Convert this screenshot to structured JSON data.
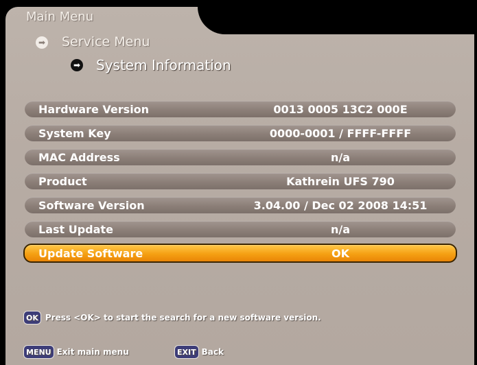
{
  "breadcrumb": {
    "main": "Main Menu",
    "service": "Service Menu",
    "current": "System Information"
  },
  "rows": [
    {
      "label": "Hardware Version",
      "value": "0013 0005 13C2 000E"
    },
    {
      "label": "System Key",
      "value": "0000-0001 / FFFF-FFFF"
    },
    {
      "label": "MAC Address",
      "value": "n/a"
    },
    {
      "label": "Product",
      "value": "Kathrein  UFS 790"
    },
    {
      "label": "Software Version",
      "value": "3.04.00 / Dec 02 2008  14:51"
    },
    {
      "label": "Last Update",
      "value": "n/a"
    },
    {
      "label": "Update Software",
      "value": "OK"
    }
  ],
  "hint": {
    "key": "OK",
    "text": "Press <OK> to start the search for a new software version."
  },
  "footer": {
    "menu_key": "MENU",
    "menu_text": "Exit main menu",
    "exit_key": "EXIT",
    "exit_text": "Back"
  },
  "colors": {
    "panel": "#b8ada5",
    "row": "#8c7f78",
    "highlight": "#f5a013"
  }
}
